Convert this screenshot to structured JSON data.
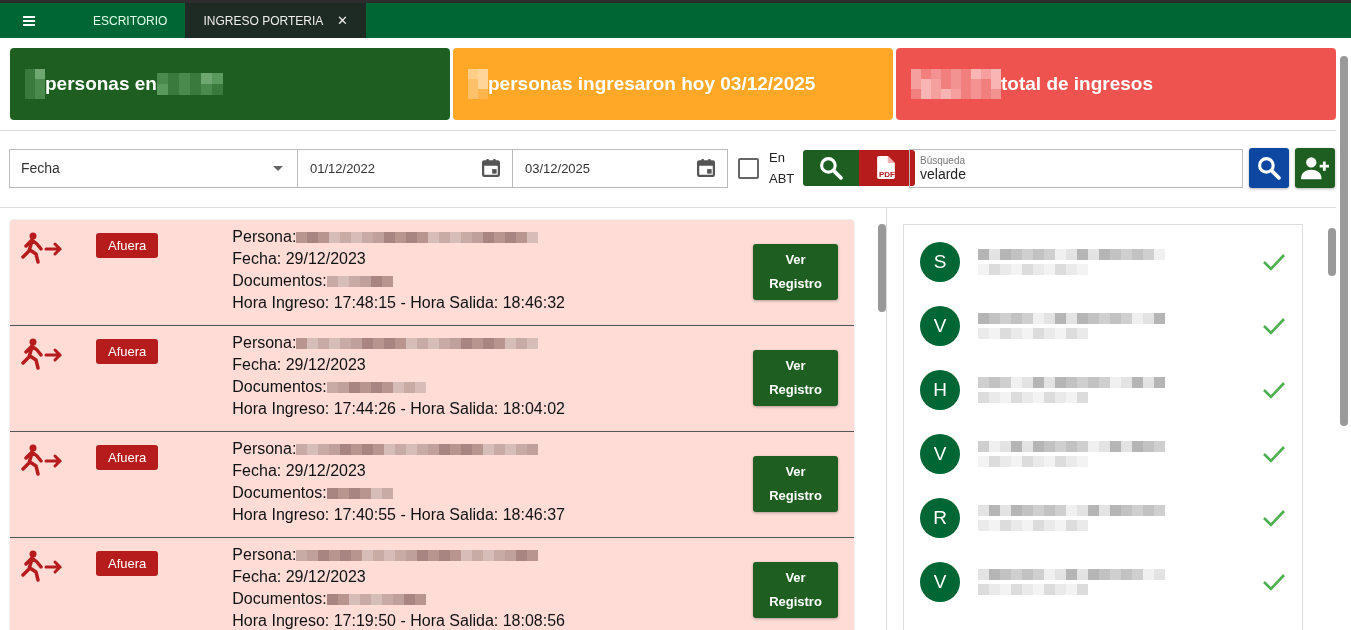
{
  "topbar": {
    "tabs": [
      {
        "label": "ESCRITORIO",
        "selected": false
      },
      {
        "label": "INGRESO PORTERIA",
        "selected": true,
        "close": "✕"
      }
    ]
  },
  "stats": [
    {
      "text": "personas en",
      "color": "#1e5e20"
    },
    {
      "text": "personas ingresaron hoy 03/12/2025",
      "color": "#ffa726"
    },
    {
      "text": "total de ingresos",
      "color": "#ef5350"
    }
  ],
  "filters": {
    "field": "Fecha",
    "date_from": "01/12/2022",
    "date_to": "03/12/2025",
    "abt": {
      "label": "En ABT",
      "checked": false
    },
    "pdf_label": "PDF",
    "search": {
      "label": "Búsqueda",
      "value": "velarde"
    }
  },
  "records": [
    {
      "status": "Afuera",
      "persona": "Persona:",
      "fecha": "Fecha: 29/12/2023",
      "documentos": "Documentos:",
      "horas": "Hora Ingreso: 17:48:15 - Hora Salida: 18:46:32",
      "button": "Ver Registro"
    },
    {
      "status": "Afuera",
      "persona": "Persona:",
      "fecha": "Fecha: 29/12/2023",
      "documentos": "Documentos:",
      "horas": "Hora Ingreso: 17:44:26 - Hora Salida: 18:04:02",
      "button": "Ver Registro"
    },
    {
      "status": "Afuera",
      "persona": "Persona:",
      "fecha": "Fecha: 29/12/2023",
      "documentos": "Documentos:",
      "horas": "Hora Ingreso: 17:40:55 - Hora Salida: 18:46:37",
      "button": "Ver Registro"
    },
    {
      "status": "Afuera",
      "persona": "Persona:",
      "fecha": "Fecha: 29/12/2023",
      "documentos": "Documentos:",
      "horas": "Hora Ingreso: 17:19:50 - Hora Salida: 18:08:56",
      "button": "Ver Registro"
    }
  ],
  "people": [
    {
      "initial": "S",
      "checked": true
    },
    {
      "initial": "V",
      "checked": true
    },
    {
      "initial": "H",
      "checked": true
    },
    {
      "initial": "V",
      "checked": true
    },
    {
      "initial": "R",
      "checked": true
    },
    {
      "initial": "V",
      "checked": true
    }
  ]
}
